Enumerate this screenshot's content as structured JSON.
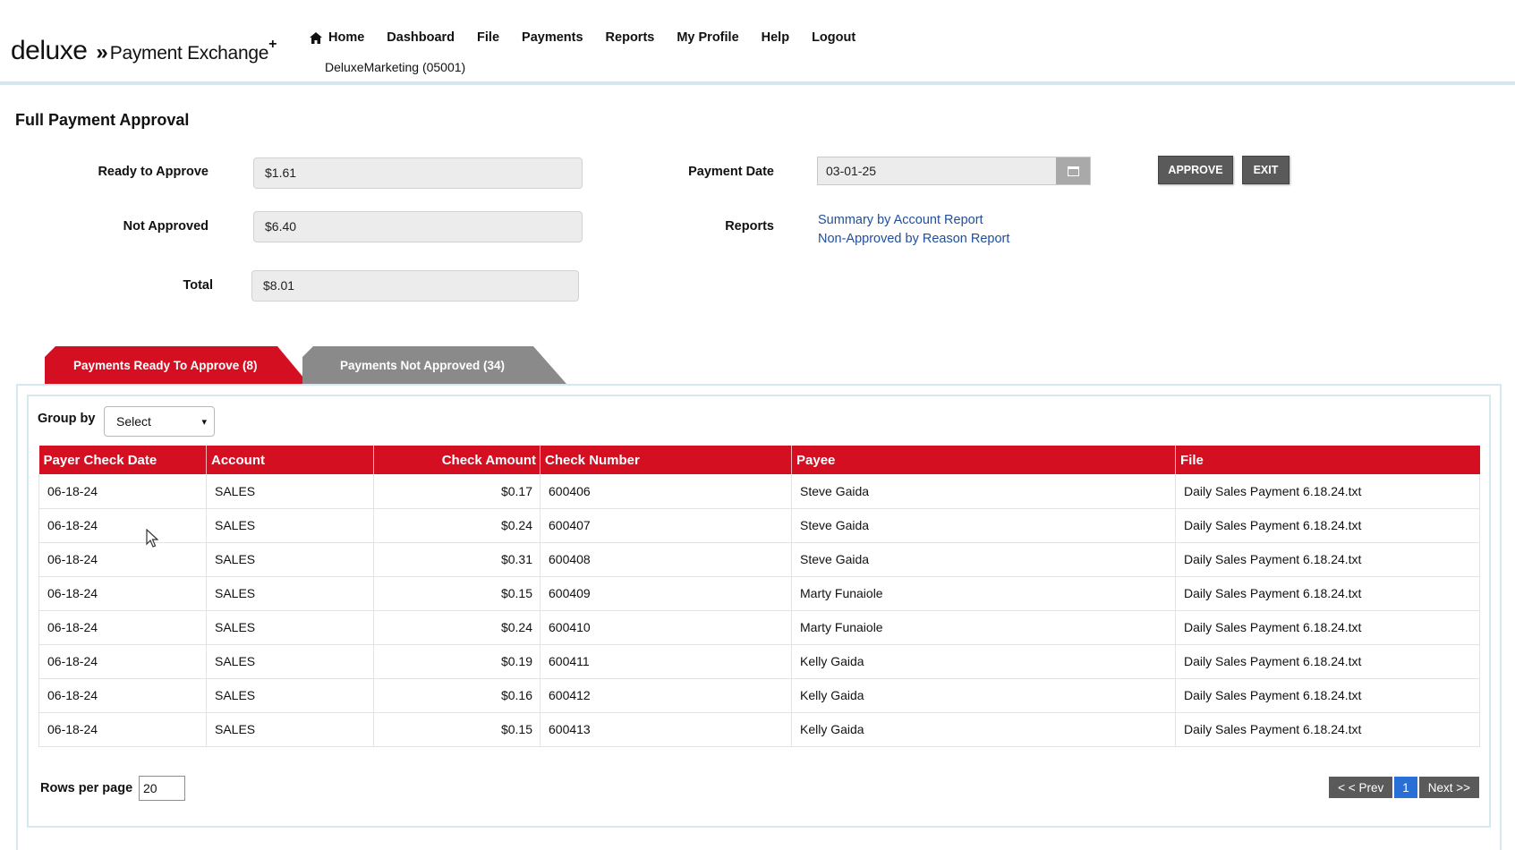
{
  "brand": {
    "deluxe": "deluxe",
    "arrows": "»",
    "product": "Payment Exchange",
    "plus": "+"
  },
  "nav": {
    "home_icon": "home-icon",
    "items": [
      "Home",
      "Dashboard",
      "File",
      "Payments",
      "Reports",
      "My Profile",
      "Help",
      "Logout"
    ]
  },
  "org": "DeluxeMarketing (05001)",
  "page_title": "Full Payment Approval",
  "summary": {
    "ready_label": "Ready to Approve",
    "ready_value": "$1.61",
    "not_approved_label": "Not Approved",
    "not_approved_value": "$6.40",
    "total_label": "Total",
    "total_value": "$8.01",
    "payment_date_label": "Payment Date",
    "payment_date_value": "03-01-25",
    "calendar_icon": "calendar-icon",
    "reports_label": "Reports",
    "report_links": [
      "Summary by Account Report",
      "Non-Approved by Reason Report"
    ]
  },
  "buttons": {
    "approve": "APPROVE",
    "exit": "EXIT"
  },
  "tabs": {
    "ready": "Payments Ready To Approve (8)",
    "not_approved": "Payments Not Approved (34)"
  },
  "group_by": {
    "label": "Group by",
    "selected": "Select",
    "chevron": "▾"
  },
  "table": {
    "headers": [
      "Payer Check Date",
      "Account",
      "Check Amount",
      "Check Number",
      "Payee",
      "File"
    ],
    "rows": [
      [
        "06-18-24",
        "SALES",
        "$0.17",
        "600406",
        "Steve Gaida",
        "Daily Sales Payment 6.18.24.txt"
      ],
      [
        "06-18-24",
        "SALES",
        "$0.24",
        "600407",
        "Steve Gaida",
        "Daily Sales Payment 6.18.24.txt"
      ],
      [
        "06-18-24",
        "SALES",
        "$0.31",
        "600408",
        "Steve Gaida",
        "Daily Sales Payment 6.18.24.txt"
      ],
      [
        "06-18-24",
        "SALES",
        "$0.15",
        "600409",
        "Marty Funaiole",
        "Daily Sales Payment 6.18.24.txt"
      ],
      [
        "06-18-24",
        "SALES",
        "$0.24",
        "600410",
        "Marty Funaiole",
        "Daily Sales Payment 6.18.24.txt"
      ],
      [
        "06-18-24",
        "SALES",
        "$0.19",
        "600411",
        "Kelly Gaida",
        "Daily Sales Payment 6.18.24.txt"
      ],
      [
        "06-18-24",
        "SALES",
        "$0.16",
        "600412",
        "Kelly Gaida",
        "Daily Sales Payment 6.18.24.txt"
      ],
      [
        "06-18-24",
        "SALES",
        "$0.15",
        "600413",
        "Kelly Gaida",
        "Daily Sales Payment 6.18.24.txt"
      ]
    ]
  },
  "pagination": {
    "rows_per_page_label": "Rows per page",
    "rows_per_page_value": "20",
    "prev": "< < Prev",
    "current": "1",
    "next": "Next >>"
  },
  "colors": {
    "accent_red": "#d50f22",
    "tab_gray": "#8a8a8a",
    "button_gray": "#5a5a5a",
    "link_blue": "#1f4e9c",
    "page_current": "#2a6fd6"
  }
}
